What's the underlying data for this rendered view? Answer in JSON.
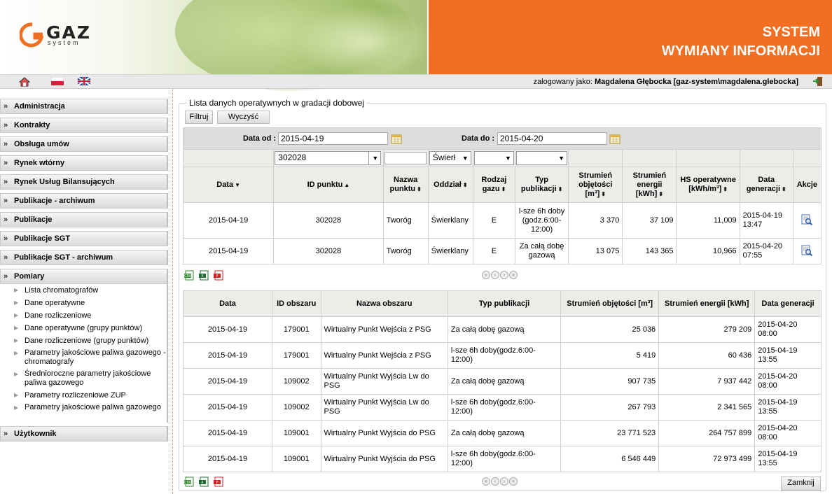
{
  "header": {
    "title_line1": "SYSTEM",
    "title_line2": "WYMIANY INFORMACJI",
    "logo_text": "GAZ",
    "logo_sub": "system"
  },
  "toolbar": {
    "logged_label": "zalogowany jako:",
    "logged_user": "Magdalena Głębocka [gaz-system\\magdalena.glebocka]"
  },
  "sidebar": {
    "sections": [
      "Administracja",
      "Kontrakty",
      "Obsługa umów",
      "Rynek wtórny",
      "Rynek Usług Bilansujących",
      "Publikacje - archiwum",
      "Publikacje",
      "Publikacje SGT",
      "Publikacje SGT - archiwum",
      "Pomiary"
    ],
    "pomiary_items": [
      "Lista chromatografów",
      "Dane operatywne",
      "Dane rozliczeniowe",
      "Dane operatywne (grupy punktów)",
      "Dane rozliczeniowe (grupy punktów)",
      "Parametry jakościowe paliwa gazowego - chromatografy",
      "Średnioroczne parametry jakościowe paliwa gazowego",
      "Parametry rozliczeniowe ZUP",
      "Parametry jakościowe paliwa gazowego"
    ],
    "last_section": "Użytkownik"
  },
  "panel": {
    "title": "Lista danych operatywnych w gradacji dobowej",
    "filter_btn": "Filtruj",
    "clear_btn": "Wyczyść",
    "close_btn": "Zamknij"
  },
  "filters": {
    "date_from_label": "Data od :",
    "date_from": "2015-04-19",
    "date_to_label": "Data do :",
    "date_to": "2015-04-20",
    "point_id": "302028",
    "oddzial": "Świerł"
  },
  "table1": {
    "headers": [
      "Data",
      "ID punktu",
      "Nazwa punktu",
      "Oddział",
      "Rodzaj gazu",
      "Typ publikacji",
      "Strumień objętości [m³]",
      "Strumień energii [kWh]",
      "HS operatywne [kWh/m³]",
      "Data generacji",
      "Akcje"
    ],
    "rows": [
      [
        "2015-04-19",
        "302028",
        "Tworóg",
        "Świerklany",
        "E",
        "l-sze 6h doby (godz.6:00-12:00)",
        "3 370",
        "37 109",
        "11,009",
        "2015-04-19 13:47"
      ],
      [
        "2015-04-19",
        "302028",
        "Tworóg",
        "Świerklany",
        "E",
        "Za całą dobę gazową",
        "13 075",
        "143 365",
        "10,966",
        "2015-04-20 07:55"
      ]
    ]
  },
  "table2": {
    "headers": [
      "Data",
      "ID obszaru",
      "Nazwa obszaru",
      "Typ publikacji",
      "Strumień objętości [m³]",
      "Strumień energii [kWh]",
      "Data generacji"
    ],
    "rows": [
      [
        "2015-04-19",
        "179001",
        "Wirtualny Punkt Wejścia z PSG",
        "Za całą dobę gazową",
        "25 036",
        "279 209",
        "2015-04-20 08:00"
      ],
      [
        "2015-04-19",
        "179001",
        "Wirtualny Punkt Wejścia z PSG",
        "l-sze 6h doby(godz.6:00-12:00)",
        "5 419",
        "60 436",
        "2015-04-19 13:55"
      ],
      [
        "2015-04-19",
        "109002",
        "Wirtualny Punkt Wyjścia Lw do PSG",
        "Za całą dobę gazową",
        "907 735",
        "7 937 442",
        "2015-04-20 08:00"
      ],
      [
        "2015-04-19",
        "109002",
        "Wirtualny Punkt Wyjścia Lw do PSG",
        "l-sze 6h doby(godz.6:00-12:00)",
        "267 793",
        "2 341 565",
        "2015-04-19 13:55"
      ],
      [
        "2015-04-19",
        "109001",
        "Wirtualny Punkt Wyjścia do PSG",
        "Za całą dobę gazową",
        "23 771 523",
        "264 757 899",
        "2015-04-20 08:00"
      ],
      [
        "2015-04-19",
        "109001",
        "Wirtualny Punkt Wyjścia do PSG",
        "l-sze 6h doby(godz.6:00-12:00)",
        "6 546 449",
        "72 973 499",
        "2015-04-19 13:55"
      ]
    ]
  },
  "colors": {
    "brand_orange": "#f26f21",
    "header_gray": "#ecece9"
  }
}
